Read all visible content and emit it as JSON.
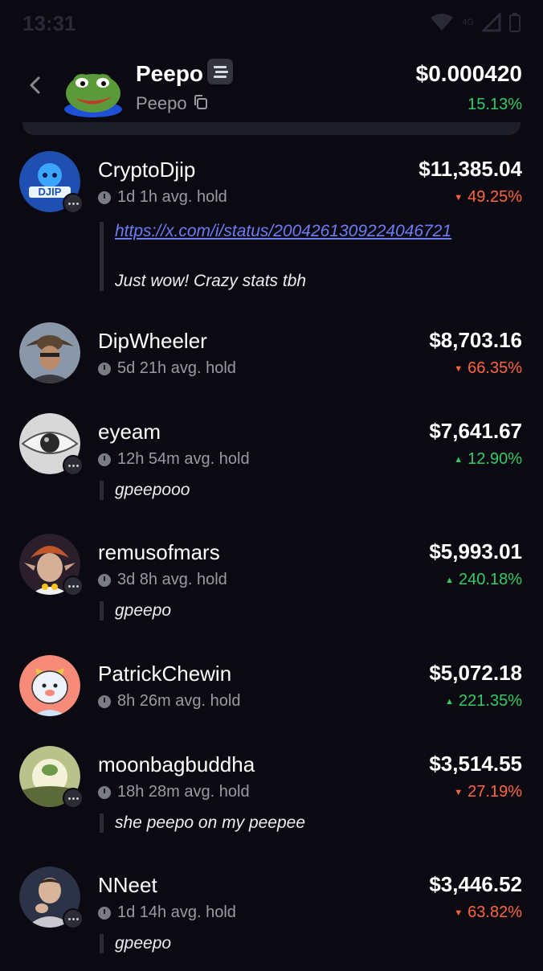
{
  "status_bar": {
    "time": "13:31",
    "network": "4G"
  },
  "header": {
    "back_icon": "chevron-left-icon",
    "token_name": "Peepo",
    "chain_icon": "solana-icon",
    "token_ticker": "Peepo",
    "copy_icon": "copy-icon",
    "price": "$0.000420",
    "change": "15.13%",
    "change_color": "#33cc66"
  },
  "holders": [
    {
      "name": "CryptoDjip",
      "hold": "1d 1h avg. hold",
      "value": "$11,385.04",
      "change": "49.25%",
      "direction": "down",
      "comment_link": "https://x.com/i/status/2004261309224046721",
      "comment": "Just wow! Crazy stats tbh",
      "avatar": "djip-logo"
    },
    {
      "name": "DipWheeler",
      "hold": "5d 21h avg. hold",
      "value": "$8,703.16",
      "change": "66.35%",
      "direction": "down",
      "avatar": "cowboy-photo"
    },
    {
      "name": "eyeam",
      "hold": "12h 54m avg. hold",
      "value": "$7,641.67",
      "change": "12.90%",
      "direction": "up",
      "comment": "gpeepooo",
      "avatar": "eye-photo"
    },
    {
      "name": "remusofmars",
      "hold": "3d 8h avg. hold",
      "value": "$5,993.01",
      "change": "240.18%",
      "direction": "up",
      "comment": "gpeepo",
      "avatar": "elf-cartoon"
    },
    {
      "name": "PatrickChewin",
      "hold": "8h 26m avg. hold",
      "value": "$5,072.18",
      "change": "221.35%",
      "direction": "up",
      "avatar": "bear-cartoon"
    },
    {
      "name": "moonbagbuddha",
      "hold": "18h 28m avg. hold",
      "value": "$3,514.55",
      "change": "27.19%",
      "direction": "down",
      "comment": "she peepo on my peepee",
      "avatar": "frog-sky"
    },
    {
      "name": "NNeet",
      "hold": "1d 14h avg. hold",
      "value": "$3,446.52",
      "change": "63.82%",
      "direction": "down",
      "comment": "gpeepo",
      "avatar": "man-photo"
    }
  ],
  "colors": {
    "background": "#0b0a12",
    "up": "#33cc66",
    "down": "#ff6640",
    "link": "#6e7cf5"
  }
}
